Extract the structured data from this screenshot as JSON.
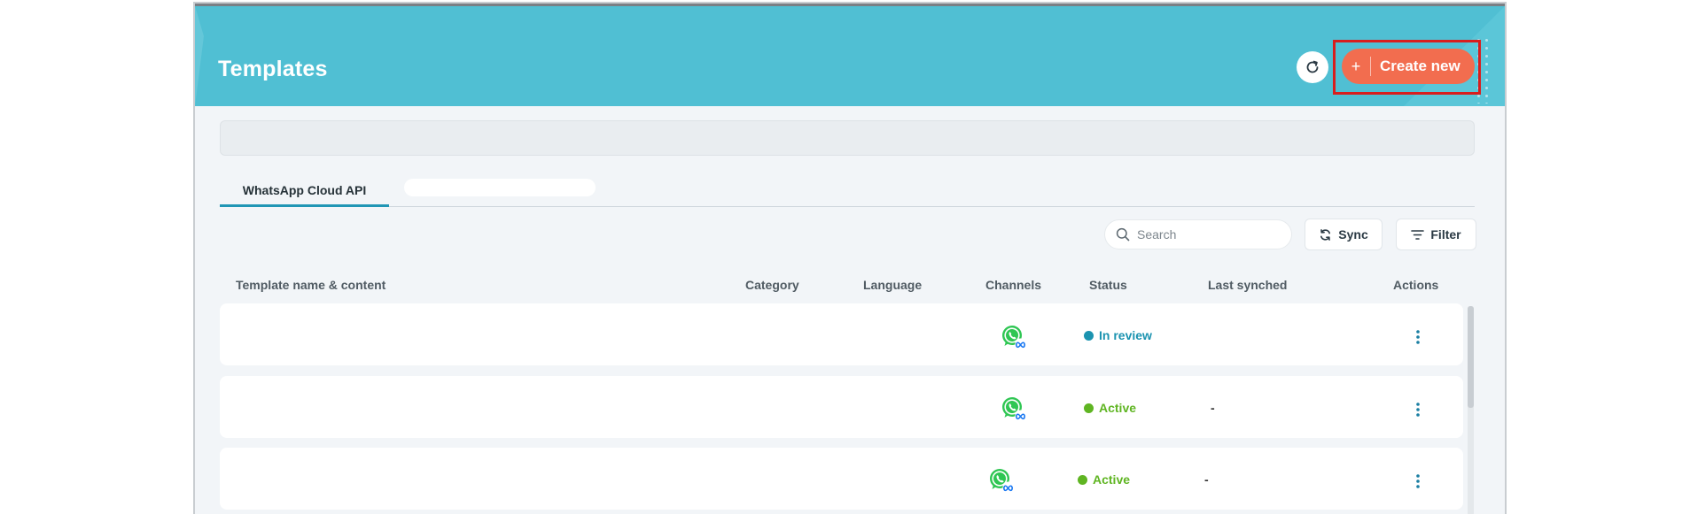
{
  "header": {
    "title": "Templates",
    "create_label": "Create new",
    "create_plus": "+"
  },
  "tabs": [
    {
      "label": "WhatsApp Cloud API",
      "active": true
    }
  ],
  "toolbar": {
    "search_placeholder": "Search",
    "sync_label": "Sync",
    "filter_label": "Filter"
  },
  "table": {
    "columns": [
      "Template name & content",
      "Category",
      "Language",
      "Channels",
      "Status",
      "Last synched",
      "Actions"
    ],
    "rows": [
      {
        "channel_icon": "whatsapp-meta-icon",
        "status": "In review",
        "status_color": "#1b93b0",
        "last_synched": ""
      },
      {
        "channel_icon": "whatsapp-meta-icon",
        "status": "Active",
        "status_color": "#5fb522",
        "last_synched": "-"
      },
      {
        "channel_icon": "whatsapp-meta-icon",
        "status": "Active",
        "status_color": "#5fb522",
        "last_synched": "-"
      }
    ]
  },
  "colors": {
    "header_bg": "#50bfd3",
    "accent_orange": "#f26d4f",
    "highlight_red": "#d81e1e",
    "tab_underline": "#2196b5",
    "action_icon": "#1b7fa3"
  }
}
